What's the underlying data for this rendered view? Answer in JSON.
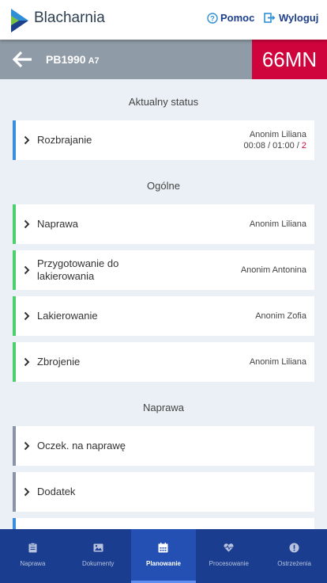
{
  "header": {
    "brand": "Blacharnia",
    "help_label": "Pomoc",
    "logout_label": "Wyloguj",
    "accent": "#1e3f8a"
  },
  "vehicle": {
    "plate": "PB1990",
    "plate_suffix": "A7",
    "code": "66MN",
    "code_color": "#d0043c"
  },
  "sections": {
    "current_status": "Aktualny status",
    "general": "Ogólne",
    "repair": "Naprawa"
  },
  "status_card": {
    "label": "Rozbrajanie",
    "assignee": "Anonim Liliana",
    "time": "00:08 / 01:00 / ",
    "count": "2",
    "bar_color": "#3b8de0"
  },
  "general_items": [
    {
      "label": "Naprawa",
      "assignee": "Anonim Liliana"
    },
    {
      "label": "Przygotowanie do lakierowania",
      "assignee": "Anonim Antonina"
    },
    {
      "label": "Lakierowanie",
      "assignee": "Anonim Zofia"
    },
    {
      "label": "Zbrojenie",
      "assignee": "Anonim Liliana"
    }
  ],
  "repair_items": [
    {
      "label": "Oczek. na naprawę"
    },
    {
      "label": "Dodatek"
    }
  ],
  "tabs": [
    {
      "label": "Naprawa",
      "icon": "clipboard-icon"
    },
    {
      "label": "Dokumenty",
      "icon": "image-icon"
    },
    {
      "label": "Planowanie",
      "icon": "calendar-icon",
      "active": true
    },
    {
      "label": "Procesowanie",
      "icon": "heartbeat-icon"
    },
    {
      "label": "Ostrzeżenia",
      "icon": "alert-icon"
    }
  ]
}
